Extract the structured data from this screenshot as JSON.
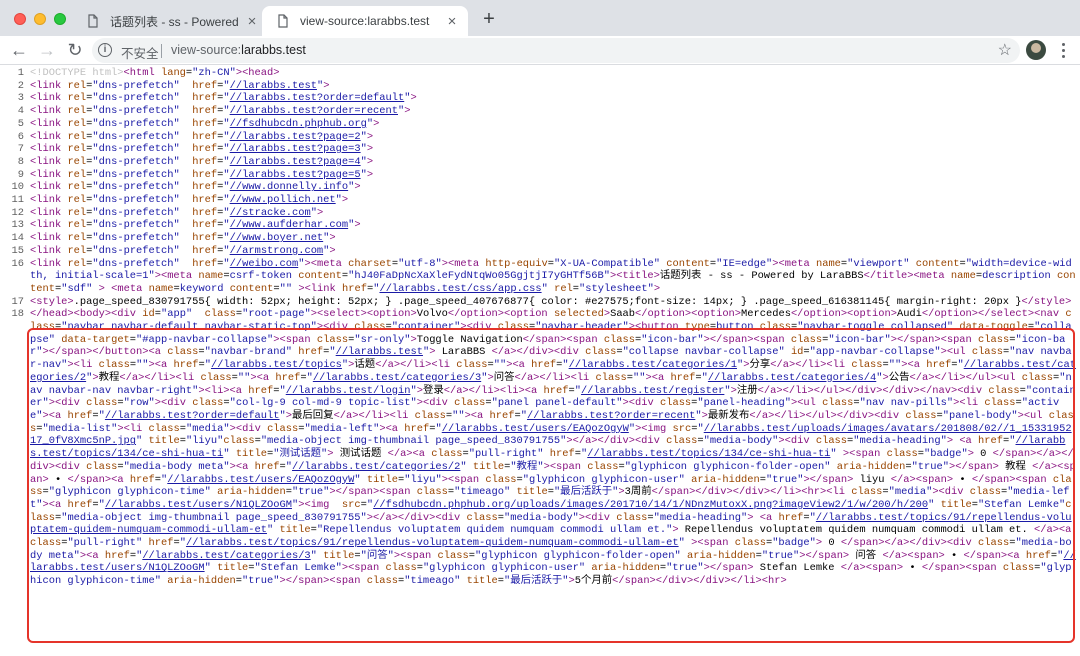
{
  "tabs": [
    {
      "title": "话题列表 - ss - Powered by Lar"
    },
    {
      "title": "view-source:larabbs.test"
    }
  ],
  "toolbar": {
    "security_label": "不安全",
    "url_scheme": "view-source:",
    "url_host": "larabbs.test",
    "new_tab_symbol": "+"
  },
  "highlight_color": "#e5342a",
  "source": {
    "lines": [
      {
        "n": "1",
        "html": "<span class='dt'>&lt;!DOCTYPE html&gt;</span><span class='tg'>&lt;html</span> <span class='an'>lang</span>=<span class='av'>\"zh-CN\"</span><span class='tg'>&gt;&lt;head&gt;</span>"
      },
      {
        "n": "2",
        "html": "<span class='tg'>&lt;link</span> <span class='an'>rel</span>=<span class='av'>\"dns-prefetch\"</span>  <span class='an'>href</span>=<span class='av'>\"<span class='lk'>//larabbs.test</span>\"</span><span class='tg'>&gt;</span>"
      },
      {
        "n": "3",
        "html": "<span class='tg'>&lt;link</span> <span class='an'>rel</span>=<span class='av'>\"dns-prefetch\"</span>  <span class='an'>href</span>=<span class='av'>\"<span class='lk'>//larabbs.test?order=default</span>\"</span><span class='tg'>&gt;</span>"
      },
      {
        "n": "4",
        "html": "<span class='tg'>&lt;link</span> <span class='an'>rel</span>=<span class='av'>\"dns-prefetch\"</span>  <span class='an'>href</span>=<span class='av'>\"<span class='lk'>//larabbs.test?order=recent</span>\"</span><span class='tg'>&gt;</span>"
      },
      {
        "n": "5",
        "html": "<span class='tg'>&lt;link</span> <span class='an'>rel</span>=<span class='av'>\"dns-prefetch\"</span>  <span class='an'>href</span>=<span class='av'>\"<span class='lk'>//fsdhubcdn.phphub.org</span>\"</span><span class='tg'>&gt;</span>"
      },
      {
        "n": "6",
        "html": "<span class='tg'>&lt;link</span> <span class='an'>rel</span>=<span class='av'>\"dns-prefetch\"</span>  <span class='an'>href</span>=<span class='av'>\"<span class='lk'>//larabbs.test?page=2</span>\"</span><span class='tg'>&gt;</span>"
      },
      {
        "n": "7",
        "html": "<span class='tg'>&lt;link</span> <span class='an'>rel</span>=<span class='av'>\"dns-prefetch\"</span>  <span class='an'>href</span>=<span class='av'>\"<span class='lk'>//larabbs.test?page=3</span>\"</span><span class='tg'>&gt;</span>"
      },
      {
        "n": "8",
        "html": "<span class='tg'>&lt;link</span> <span class='an'>rel</span>=<span class='av'>\"dns-prefetch\"</span>  <span class='an'>href</span>=<span class='av'>\"<span class='lk'>//larabbs.test?page=4</span>\"</span><span class='tg'>&gt;</span>"
      },
      {
        "n": "9",
        "html": "<span class='tg'>&lt;link</span> <span class='an'>rel</span>=<span class='av'>\"dns-prefetch\"</span>  <span class='an'>href</span>=<span class='av'>\"<span class='lk'>//larabbs.test?page=5</span>\"</span><span class='tg'>&gt;</span>"
      },
      {
        "n": "10",
        "html": "<span class='tg'>&lt;link</span> <span class='an'>rel</span>=<span class='av'>\"dns-prefetch\"</span>  <span class='an'>href</span>=<span class='av'>\"<span class='lk'>//www.donnelly.info</span>\"</span><span class='tg'>&gt;</span>"
      },
      {
        "n": "11",
        "html": "<span class='tg'>&lt;link</span> <span class='an'>rel</span>=<span class='av'>\"dns-prefetch\"</span>  <span class='an'>href</span>=<span class='av'>\"<span class='lk'>//www.pollich.net</span>\"</span><span class='tg'>&gt;</span>"
      },
      {
        "n": "12",
        "html": "<span class='tg'>&lt;link</span> <span class='an'>rel</span>=<span class='av'>\"dns-prefetch\"</span>  <span class='an'>href</span>=<span class='av'>\"<span class='lk'>//stracke.com</span>\"</span><span class='tg'>&gt;</span>"
      },
      {
        "n": "13",
        "html": "<span class='tg'>&lt;link</span> <span class='an'>rel</span>=<span class='av'>\"dns-prefetch\"</span>  <span class='an'>href</span>=<span class='av'>\"<span class='lk'>//www.aufderhar.com</span>\"</span><span class='tg'>&gt;</span>"
      },
      {
        "n": "14",
        "html": "<span class='tg'>&lt;link</span> <span class='an'>rel</span>=<span class='av'>\"dns-prefetch\"</span>  <span class='an'>href</span>=<span class='av'>\"<span class='lk'>//www.boyer.net</span>\"</span><span class='tg'>&gt;</span>"
      },
      {
        "n": "15",
        "html": "<span class='tg'>&lt;link</span> <span class='an'>rel</span>=<span class='av'>\"dns-prefetch\"</span>  <span class='an'>href</span>=<span class='av'>\"<span class='lk'>//armstrong.com</span>\"</span><span class='tg'>&gt;</span>"
      },
      {
        "n": "16",
        "html": "<span class='tg'>&lt;link</span> <span class='an'>rel</span>=<span class='av'>\"dns-prefetch\"</span>  <span class='an'>href</span>=<span class='av'>\"<span class='lk'>//weibo.com</span>\"</span><span class='tg'>&gt;&lt;meta</span> <span class='an'>charset</span>=<span class='av'>\"utf-8\"</span><span class='tg'>&gt;&lt;meta</span> <span class='an'>http-equiv</span>=<span class='av'>\"X-UA-Compatible\"</span> <span class='an'>content</span>=<span class='av'>\"IE=edge\"</span><span class='tg'>&gt;&lt;meta</span> <span class='an'>name</span>=<span class='av'>\"viewport\"</span> <span class='an'>content</span>=<span class='av'>\"width=device-width, initial-scale=1\"</span><span class='tg'>&gt;&lt;meta</span> <span class='an'>name</span>=<span class='av'>csrf-token</span> <span class='an'>content</span>=<span class='av'>\"hJ40FaDpNcXaXleFydNtqWo05GgjtjI7yGHTf56B\"</span><span class='tg'>&gt;&lt;title&gt;</span>话题列表 - ss - Powered by LaraBBS<span class='tg'>&lt;/title&gt;&lt;meta</span> <span class='an'>name</span>=<span class='av'>description</span> <span class='an'>content</span>=<span class='av'>\"sdf\"</span> <span class='tg'>&gt;</span> <span class='tg'>&lt;meta</span> <span class='an'>name</span>=<span class='av'>keyword</span> <span class='an'>content</span>=<span class='av'>\"\"</span> <span class='tg'>&gt;&lt;link</span> <span class='an'>href</span>=<span class='av'>\"<span class='lk'>//larabbs.test/css/app.css</span>\"</span> <span class='an'>rel</span>=<span class='av'>\"stylesheet\"</span><span class='tg'>&gt;</span>"
      },
      {
        "n": "17",
        "html": "<span class='tg'>&lt;style&gt;</span>.page_speed_830791755{ width: 52px; height: 52px; } .page_speed_407676877{ color: #e27575;font-size: 14px; } .page_speed_616381145{ margin-right: 20px }<span class='tg'>&lt;/style&gt;</span>"
      },
      {
        "n": "18",
        "html": "<span class='tg'>&lt;/head&gt;&lt;body&gt;&lt;div</span> <span class='an'>id</span>=<span class='av'>\"app\"</span>  <span class='an'>class</span>=<span class='av'>\"root-page\"</span><span class='tg'>&gt;&lt;select&gt;&lt;option&gt;</span>Volvo<span class='tg'>&lt;/option&gt;&lt;option</span> <span class='an'>selected</span><span class='tg'>&gt;</span>Saab<span class='tg'>&lt;/option&gt;&lt;option&gt;</span>Mercedes<span class='tg'>&lt;/option&gt;&lt;option&gt;</span>Audi<span class='tg'>&lt;/option&gt;&lt;/select&gt;&lt;nav</span> <span class='an'>class</span>=<span class='av'>\"navbar navbar-default navbar-static-top\"</span><span class='tg'>&gt;&lt;div</span> <span class='an'>class</span>=<span class='av'>\"container\"</span><span class='tg'>&gt;&lt;div</span> <span class='an'>class</span>=<span class='av'>\"navbar-header\"</span><span class='tg'>&gt;&lt;button</span> <span class='an'>type</span>=<span class='av'>button</span> <span class='an'>class</span>=<span class='av'>\"navbar-toggle collapsed\"</span> <span class='an'>data-toggle</span>=<span class='av'>\"collapse\"</span> <span class='an'>data-target</span>=<span class='av'>\"#app-navbar-collapse\"</span><span class='tg'>&gt;&lt;span</span> <span class='an'>class</span>=<span class='av'>\"sr-only\"</span><span class='tg'>&gt;</span>Toggle Navigation<span class='tg'>&lt;/span&gt;&lt;span</span> <span class='an'>class</span>=<span class='av'>\"icon-bar\"</span><span class='tg'>&gt;&lt;/span&gt;&lt;span</span> <span class='an'>class</span>=<span class='av'>\"icon-bar\"</span><span class='tg'>&gt;&lt;/span&gt;&lt;span</span> <span class='an'>class</span>=<span class='av'>\"icon-bar\"</span><span class='tg'>&gt;&lt;/span&gt;&lt;/button&gt;&lt;a</span> <span class='an'>class</span>=<span class='av'>\"navbar-brand\"</span> <span class='an'>href</span>=<span class='av'>\"<span class='lk'>//larabbs.test</span>\"</span><span class='tg'>&gt;</span> LaraBBS <span class='tg'>&lt;/a&gt;&lt;/div&gt;&lt;div</span> <span class='an'>class</span>=<span class='av'>\"collapse navbar-collapse\"</span> <span class='an'>id</span>=<span class='av'>\"app-navbar-collapse\"</span><span class='tg'>&gt;&lt;ul</span> <span class='an'>class</span>=<span class='av'>\"nav navbar-nav\"</span><span class='tg'>&gt;&lt;li</span> <span class='an'>class</span>=<span class='av'>\"\"</span><span class='tg'>&gt;&lt;a</span> <span class='an'>href</span>=<span class='av'>\"<span class='lk'>//larabbs.test/topics</span>\"</span><span class='tg'>&gt;</span>话题<span class='tg'>&lt;/a&gt;&lt;/li&gt;&lt;li</span> <span class='an'>class</span>=<span class='av'>\"\"</span><span class='tg'>&gt;&lt;a</span> <span class='an'>href</span>=<span class='av'>\"<span class='lk'>//larabbs.test/categories/1</span>\"</span><span class='tg'>&gt;</span>分享<span class='tg'>&lt;/a&gt;&lt;/li&gt;&lt;li</span> <span class='an'>class</span>=<span class='av'>\"\"</span><span class='tg'>&gt;&lt;a</span> <span class='an'>href</span>=<span class='av'>\"<span class='lk'>//larabbs.test/categories/2</span>\"</span><span class='tg'>&gt;</span>教程<span class='tg'>&lt;/a&gt;&lt;/li&gt;&lt;li</span> <span class='an'>class</span>=<span class='av'>\"\"</span><span class='tg'>&gt;&lt;a</span> <span class='an'>href</span>=<span class='av'>\"<span class='lk'>//larabbs.test/categories/3</span>\"</span><span class='tg'>&gt;</span>问答<span class='tg'>&lt;/a&gt;&lt;/li&gt;&lt;li</span> <span class='an'>class</span>=<span class='av'>\"\"</span><span class='tg'>&gt;&lt;a</span> <span class='an'>href</span>=<span class='av'>\"<span class='lk'>//larabbs.test/categories/4</span>\"</span><span class='tg'>&gt;</span>公告<span class='tg'>&lt;/a&gt;&lt;/li&gt;&lt;/ul&gt;&lt;ul</span> <span class='an'>class</span>=<span class='av'>\"nav navbar-nav navbar-right\"</span><span class='tg'>&gt;&lt;li&gt;&lt;a</span> <span class='an'>href</span>=<span class='av'>\"<span class='lk'>//larabbs.test/login</span>\"</span><span class='tg'>&gt;</span>登录<span class='tg'>&lt;/a&gt;&lt;/li&gt;&lt;li&gt;&lt;a</span> <span class='an'>href</span>=<span class='av'>\"<span class='lk'>//larabbs.test/register</span>\"</span><span class='tg'>&gt;</span>注册<span class='tg'>&lt;/a&gt;&lt;/li&gt;&lt;/ul&gt;&lt;/div&gt;&lt;/div&gt;&lt;/nav&gt;&lt;div</span> <span class='an'>class</span>=<span class='av'>\"container\"</span><span class='tg'>&gt;&lt;div</span> <span class='an'>class</span>=<span class='av'>\"row\"</span><span class='tg'>&gt;&lt;div</span> <span class='an'>class</span>=<span class='av'>\"col-lg-9 col-md-9 topic-list\"</span><span class='tg'>&gt;&lt;div</span> <span class='an'>class</span>=<span class='av'>\"panel panel-default\"</span><span class='tg'>&gt;&lt;div</span> <span class='an'>class</span>=<span class='av'>\"panel-heading\"</span><span class='tg'>&gt;&lt;ul</span> <span class='an'>class</span>=<span class='av'>\"nav nav-pills\"</span><span class='tg'>&gt;&lt;li</span> <span class='an'>class</span>=<span class='av'>\"active\"</span><span class='tg'>&gt;&lt;a</span> <span class='an'>href</span>=<span class='av'>\"<span class='lk'>//larabbs.test?order=default</span>\"</span><span class='tg'>&gt;</span>最后回复<span class='tg'>&lt;/a&gt;&lt;/li&gt;&lt;li</span> <span class='an'>class</span>=<span class='av'>\"\"</span><span class='tg'>&gt;&lt;a</span> <span class='an'>href</span>=<span class='av'>\"<span class='lk'>//larabbs.test?order=recent</span>\"</span><span class='tg'>&gt;</span>最新发布<span class='tg'>&lt;/a&gt;&lt;/li&gt;&lt;/ul&gt;&lt;/div&gt;&lt;div</span> <span class='an'>class</span>=<span class='av'>\"panel-body\"</span><span class='tg'>&gt;&lt;ul</span> <span class='an'>class</span>=<span class='av'>\"media-list\"</span><span class='tg'>&gt;&lt;li</span> <span class='an'>class</span>=<span class='av'>\"media\"</span><span class='tg'>&gt;&lt;div</span> <span class='an'>class</span>=<span class='av'>\"media-left\"</span><span class='tg'>&gt;&lt;a</span> <span class='an'>href</span>=<span class='av'>\"<span class='lk'>//larabbs.test/users/EAQozOgyW</span>\"</span><span class='tg'>&gt;&lt;img</span> <span class='an'>src</span>=<span class='av'>\"<span class='lk'>//larabbs.test/uploads/images/avatars/201808/02//1_1533195217_0fV8Xmc5nP.jpg</span>\"</span> <span class='an'>title</span>=<span class='av'>\"liyu\"</span><span class='an'>class</span>=<span class='av'>\"media-object img-thumbnail page_speed_830791755\"</span><span class='tg'>&gt;&lt;/a&gt;&lt;/div&gt;&lt;div</span> <span class='an'>class</span>=<span class='av'>\"media-body\"</span><span class='tg'>&gt;&lt;div</span> <span class='an'>class</span>=<span class='av'>\"media-heading\"</span><span class='tg'>&gt;</span> <span class='tg'>&lt;a</span> <span class='an'>href</span>=<span class='av'>\"<span class='lk'>//larabbs.test/topics/134/ce-shi-hua-ti</span>\"</span> <span class='an'>title</span>=<span class='av'>\"测试话题\"</span><span class='tg'>&gt;</span> 测试话题 <span class='tg'>&lt;/a&gt;&lt;a</span> <span class='an'>class</span>=<span class='av'>\"pull-right\"</span> <span class='an'>href</span>=<span class='av'>\"<span class='lk'>//larabbs.test/topics/134/ce-shi-hua-ti</span>\"</span> <span class='tg'>&gt;&lt;span</span> <span class='an'>class</span>=<span class='av'>\"badge\"</span><span class='tg'>&gt;</span> 0 <span class='tg'>&lt;/span&gt;&lt;/a&gt;&lt;/div&gt;&lt;div</span> <span class='an'>class</span>=<span class='av'>\"media-body meta\"</span><span class='tg'>&gt;&lt;a</span> <span class='an'>href</span>=<span class='av'>\"<span class='lk'>//larabbs.test/categories/2</span>\"</span> <span class='an'>title</span>=<span class='av'>\"教程\"</span><span class='tg'>&gt;&lt;span</span> <span class='an'>class</span>=<span class='av'>\"glyphicon glyphicon-folder-open\"</span> <span class='an'>aria-hidden</span>=<span class='av'>\"true\"</span><span class='tg'>&gt;&lt;/span&gt;</span> 教程 <span class='tg'>&lt;/a&gt;&lt;span&gt;</span> • <span class='tg'>&lt;/span&gt;&lt;a</span> <span class='an'>href</span>=<span class='av'>\"<span class='lk'>//larabbs.test/users/EAQozOgyW</span>\"</span> <span class='an'>title</span>=<span class='av'>\"liyu\"</span><span class='tg'>&gt;&lt;span</span> <span class='an'>class</span>=<span class='av'>\"glyphicon glyphicon-user\"</span> <span class='an'>aria-hidden</span>=<span class='av'>\"true\"</span><span class='tg'>&gt;&lt;/span&gt;</span> liyu <span class='tg'>&lt;/a&gt;&lt;span&gt;</span> • <span class='tg'>&lt;/span&gt;&lt;span</span> <span class='an'>class</span>=<span class='av'>\"glyphicon glyphicon-time\"</span> <span class='an'>aria-hidden</span>=<span class='av'>\"true\"</span><span class='tg'>&gt;&lt;/span&gt;&lt;span</span> <span class='an'>class</span>=<span class='av'>\"timeago\"</span> <span class='an'>title</span>=<span class='av'>\"最后活跃于\"</span><span class='tg'>&gt;</span>3周前<span class='tg'>&lt;/span&gt;&lt;/div&gt;&lt;/div&gt;&lt;/li&gt;&lt;hr&gt;&lt;li</span> <span class='an'>class</span>=<span class='av'>\"media\"</span><span class='tg'>&gt;&lt;div</span> <span class='an'>class</span>=<span class='av'>\"media-left\"</span><span class='tg'>&gt;&lt;a</span> <span class='an'>href</span>=<span class='av'>\"<span class='lk'>//larabbs.test/users/N1QLZOoGM</span>\"</span><span class='tg'>&gt;&lt;img</span>  <span class='an'>src</span>=<span class='av'>\"<span class='lk'>//fsdhubcdn.phphub.org/uploads/images/201710/14/1/NDnzMutoxX.png?imageView2/1/w/200/h/200</span>\"</span> <span class='an'>title</span>=<span class='av'>\"Stefan Lemke\"</span><span class='an'>class</span>=<span class='av'>\"media-object img-thumbnail page_speed_830791755\"</span><span class='tg'>&gt;&lt;/a&gt;&lt;/div&gt;&lt;div</span> <span class='an'>class</span>=<span class='av'>\"media-body\"</span><span class='tg'>&gt;&lt;div</span> <span class='an'>class</span>=<span class='av'>\"media-heading\"</span><span class='tg'>&gt;</span> <span class='tg'>&lt;a</span> <span class='an'>href</span>=<span class='av'>\"<span class='lk'>//larabbs.test/topics/91/repellendus-voluptatem-quidem-numquam-commodi-ullam-et</span>\"</span> <span class='an'>title</span>=<span class='av'>\"Repellendus voluptatem quidem numquam commodi ullam et.\"</span><span class='tg'>&gt;</span> Repellendus voluptatem quidem numquam commodi ullam et. <span class='tg'>&lt;/a&gt;&lt;a</span> <span class='an'>class</span>=<span class='av'>\"pull-right\"</span> <span class='an'>href</span>=<span class='av'>\"<span class='lk'>//larabbs.test/topics/91/repellendus-voluptatem-quidem-numquam-commodi-ullam-et</span>\"</span> <span class='tg'>&gt;&lt;span</span> <span class='an'>class</span>=<span class='av'>\"badge\"</span><span class='tg'>&gt;</span> 0 <span class='tg'>&lt;/span&gt;&lt;/a&gt;&lt;/div&gt;&lt;div</span> <span class='an'>class</span>=<span class='av'>\"media-body meta\"</span><span class='tg'>&gt;&lt;a</span> <span class='an'>href</span>=<span class='av'>\"<span class='lk'>//larabbs.test/categories/3</span>\"</span> <span class='an'>title</span>=<span class='av'>\"问答\"</span><span class='tg'>&gt;&lt;span</span> <span class='an'>class</span>=<span class='av'>\"glyphicon glyphicon-folder-open\"</span> <span class='an'>aria-hidden</span>=<span class='av'>\"true\"</span><span class='tg'>&gt;&lt;/span&gt;</span> 问答 <span class='tg'>&lt;/a&gt;&lt;span&gt;</span> • <span class='tg'>&lt;/span&gt;&lt;a</span> <span class='an'>href</span>=<span class='av'>\"<span class='lk'>//larabbs.test/users/N1QLZOoGM</span>\"</span> <span class='an'>title</span>=<span class='av'>\"Stefan Lemke\"</span><span class='tg'>&gt;&lt;span</span> <span class='an'>class</span>=<span class='av'>\"glyphicon glyphicon-user\"</span> <span class='an'>aria-hidden</span>=<span class='av'>\"true\"</span><span class='tg'>&gt;&lt;/span&gt;</span> Stefan Lemke <span class='tg'>&lt;/a&gt;&lt;span&gt;</span> • <span class='tg'>&lt;/span&gt;&lt;span</span> <span class='an'>class</span>=<span class='av'>\"glyphicon glyphicon-time\"</span> <span class='an'>aria-hidden</span>=<span class='av'>\"true\"</span><span class='tg'>&gt;&lt;/span&gt;&lt;span</span> <span class='an'>class</span>=<span class='av'>\"timeago\"</span> <span class='an'>title</span>=<span class='av'>\"最后活跃于\"</span><span class='tg'>&gt;</span>5个月前<span class='tg'>&lt;/span&gt;&lt;/div&gt;&lt;/div&gt;&lt;/li&gt;&lt;hr&gt;</span>"
      }
    ]
  }
}
